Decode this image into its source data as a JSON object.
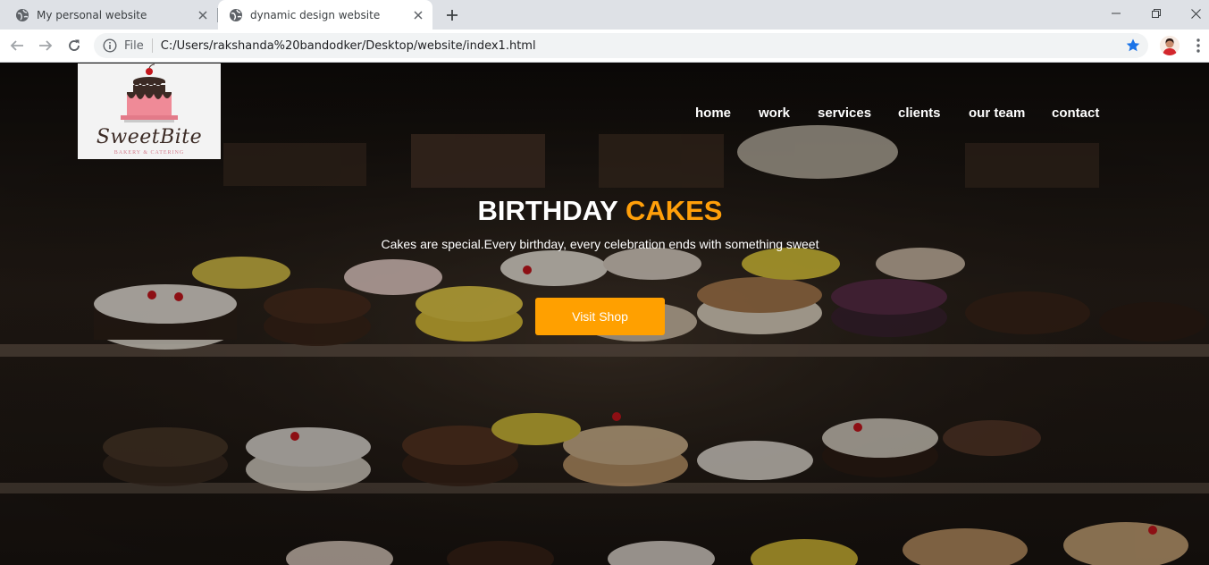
{
  "browser": {
    "tabs": [
      {
        "title": "My personal website",
        "active": false
      },
      {
        "title": "dynamic design website",
        "active": true
      }
    ],
    "address_bar": {
      "scheme_label": "File",
      "url": "C:/Users/rakshanda%20bandodker/Desktop/website/index1.html",
      "bookmarked": true
    },
    "colors": {
      "star": "#1a73e8",
      "tabstrip": "#dee1e6"
    }
  },
  "page": {
    "logo": {
      "name": "SweetBite",
      "tagline": "BAKERY & CATERING"
    },
    "nav": [
      "home",
      "work",
      "services",
      "clients",
      "our team",
      "contact"
    ],
    "hero": {
      "title_main": "BIRTHDAY",
      "title_accent": "CAKES",
      "subtitle": "Cakes are special.Every birthday, every celebration ends with something sweet",
      "cta_label": "Visit Shop"
    },
    "colors": {
      "accent": "#ff9f0a",
      "button": "#ffa000",
      "text": "#ffffff"
    }
  }
}
